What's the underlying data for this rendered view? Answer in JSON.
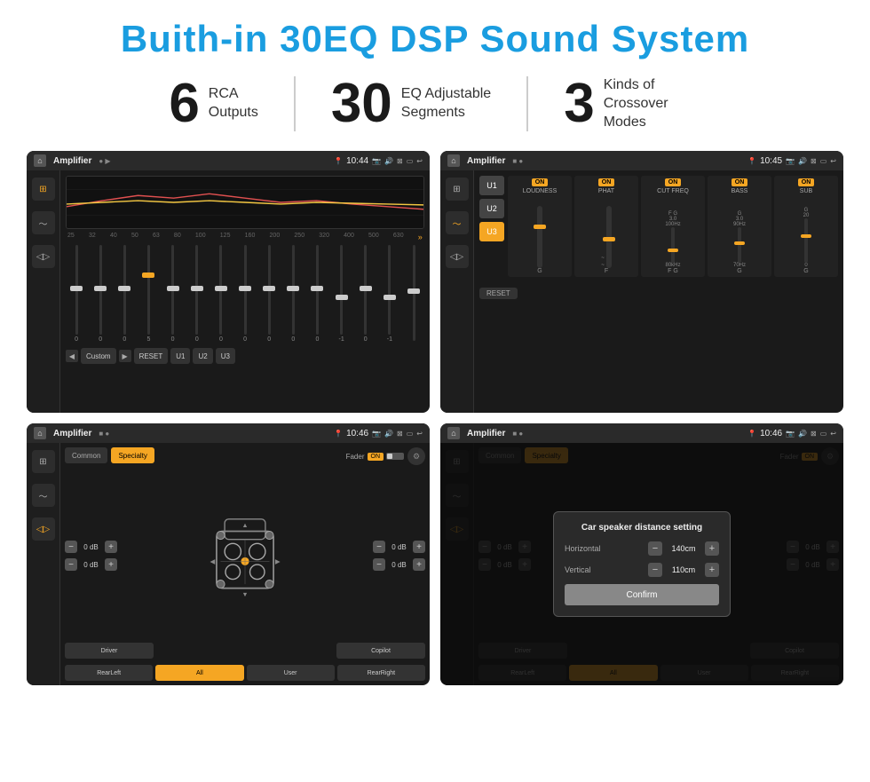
{
  "header": {
    "title": "Buith-in 30EQ DSP Sound System"
  },
  "stats": [
    {
      "number": "6",
      "label": "RCA\nOutputs"
    },
    {
      "number": "30",
      "label": "EQ Adjustable\nSegments"
    },
    {
      "number": "3",
      "label": "Kinds of\nCrossover Modes"
    }
  ],
  "screens": [
    {
      "id": "screen1",
      "statusBar": {
        "title": "Amplifier",
        "time": "10:44"
      },
      "type": "eq"
    },
    {
      "id": "screen2",
      "statusBar": {
        "title": "Amplifier",
        "time": "10:45"
      },
      "type": "crossover"
    },
    {
      "id": "screen3",
      "statusBar": {
        "title": "Amplifier",
        "time": "10:46"
      },
      "type": "speaker"
    },
    {
      "id": "screen4",
      "statusBar": {
        "title": "Amplifier",
        "time": "10:46"
      },
      "type": "dialog"
    }
  ],
  "eq": {
    "frequencies": [
      "25",
      "32",
      "40",
      "50",
      "63",
      "80",
      "100",
      "125",
      "160",
      "200",
      "250",
      "320",
      "400",
      "500",
      "630"
    ],
    "values": [
      "0",
      "0",
      "0",
      "5",
      "0",
      "0",
      "0",
      "0",
      "0",
      "0",
      "0",
      "-1",
      "0",
      "-1",
      ""
    ],
    "buttons": [
      "Custom",
      "RESET",
      "U1",
      "U2",
      "U3"
    ]
  },
  "crossover": {
    "units": [
      "U1",
      "U2",
      "U3"
    ],
    "selectedUnit": "U3",
    "columns": [
      {
        "label": "LOUDNESS",
        "on": true
      },
      {
        "label": "PHAT",
        "on": true
      },
      {
        "label": "CUT FREQ",
        "on": true
      },
      {
        "label": "BASS",
        "on": true
      },
      {
        "label": "SUB",
        "on": true
      }
    ],
    "resetBtn": "RESET"
  },
  "speaker": {
    "tabs": [
      "Common",
      "Specialty"
    ],
    "activeTab": "Specialty",
    "faderLabel": "Fader",
    "faderOn": "ON",
    "volumes": [
      {
        "left": "0 dB",
        "right": "0 dB"
      },
      {
        "left": "0 dB",
        "right": "0 dB"
      }
    ],
    "buttons": [
      "Driver",
      "",
      "Copilot",
      "RearLeft",
      "All",
      "User",
      "RearRight"
    ]
  },
  "dialog": {
    "title": "Car speaker distance setting",
    "horizontal": {
      "label": "Horizontal",
      "value": "140cm"
    },
    "vertical": {
      "label": "Vertical",
      "value": "110cm"
    },
    "confirmBtn": "Confirm",
    "rightVolumeTop": "0 dB",
    "rightVolumeBottom": "0 dB"
  }
}
